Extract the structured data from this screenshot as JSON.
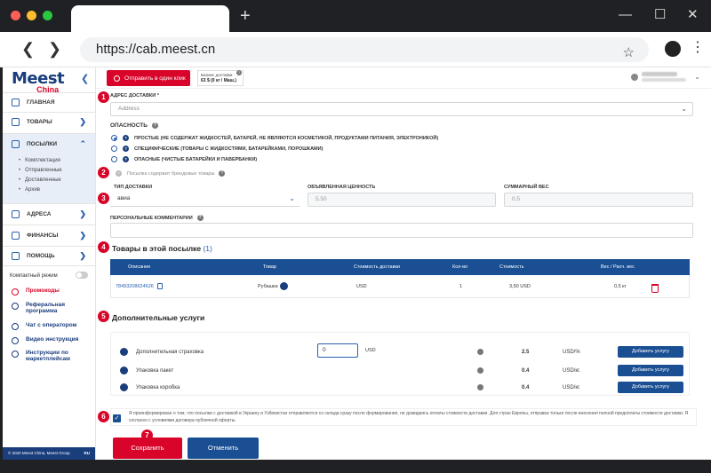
{
  "browser": {
    "url": "https://cab.meest.cn",
    "new_tab": "+",
    "back": "❮",
    "forward": "❯",
    "star": "☆",
    "menu": "⋮",
    "minimize": "—",
    "maximize": "☐",
    "close": "✕"
  },
  "sidebar": {
    "logo_main": "Meest",
    "logo_sub": "China",
    "collapse": "❮",
    "items": [
      {
        "label": "ГЛАВНАЯ"
      },
      {
        "label": "ТОВАРЫ"
      },
      {
        "label": "ПОСЫЛКИ"
      },
      {
        "label": "АДРЕСА"
      },
      {
        "label": "ФИНАНСЫ"
      },
      {
        "label": "ПОМОЩЬ"
      }
    ],
    "chevron_right": "❯",
    "chevron_down": "⌃",
    "subitems": [
      "Комплектация",
      "Отправленные",
      "Доставленные",
      "Архив"
    ],
    "compact_mode": "Компактный режим",
    "links": [
      {
        "label": "Промокоды"
      },
      {
        "label": "Реферальная программа"
      },
      {
        "label": "Чат с оператором"
      },
      {
        "label": "Видео инструкция"
      },
      {
        "label": "Инструкции по маркетплейсам"
      }
    ],
    "footer": "© 2020 Meest China, Meest Group",
    "lang": "RU"
  },
  "header": {
    "send_button": "Отправить в один клик",
    "balance_label": "Баланс доставки",
    "balance_value": "63 $ (0 кг / Маш.)",
    "help": "?",
    "dropdown": "⌄"
  },
  "form": {
    "address_label": "АДРЕС ДОСТАВКИ *",
    "address_placeholder": "Address",
    "danger_label": "ОПАСНОСТЬ",
    "help": "?",
    "dropdown": "⌄",
    "danger_options": [
      {
        "label": "ПРОСТЫЕ (НЕ СОДЕРЖАТ ЖИДКОСТЕЙ, БАТАРЕЙ, НЕ ЯВЛЯЮТСЯ КОСМЕТИКОЙ, ПРОДУКТАМИ ПИТАНИЯ, ЭЛЕКТРОНИКОЙ)",
        "selected": true
      },
      {
        "label": "СПЕЦИФИЧЕСКИЕ (ТОВАРЫ С ЖИДКОСТЯМИ, БАТАРЕЙКАМИ, ПОРОШКАМИ)",
        "selected": false
      },
      {
        "label": "ОПАСНЫЕ (ЧИСТЫЕ БАТАРЕЙКИ И ПАВЕРБАНКИ)",
        "selected": false
      }
    ],
    "brand_checkbox": "Посылка содержит брендовые товары",
    "delivery_type_label": "ТИП ДОСТАВКИ",
    "delivery_type_value": "авиа",
    "declared_value_label": "ОБЪЯВЛЕННАЯ ЦЕННОСТЬ",
    "declared_value": "5.50",
    "total_weight_label": "СУММАРНЫЙ ВЕС",
    "total_weight": "0.5",
    "comments_label": "ПЕРСОНАЛЬНЫЕ КОММЕНТАРИИ"
  },
  "steps": [
    "1",
    "2",
    "3",
    "4",
    "5",
    "6",
    "7"
  ],
  "goods": {
    "title": "Товары в этой посылке",
    "count": "(1)",
    "columns": [
      "Описание",
      "Товар",
      "Стоимость доставки",
      "Кол-во",
      "Стоимость",
      "Вес / Расч. вес"
    ],
    "row": {
      "description": "78493208624626",
      "item": "Рубашка",
      "delivery_cost": "USD",
      "qty": "1",
      "cost": "3,50 USD",
      "weight": "0,5 кг"
    }
  },
  "services": {
    "title": "Дополнительные услуги",
    "help": "?",
    "insurance_input": "0",
    "insurance_currency": "USD",
    "rows": [
      {
        "name": "Дополнительная страховка",
        "value": "2.5",
        "unit": "USD/%",
        "button": "Добавить услугу"
      },
      {
        "name": "Упаковка пакет",
        "value": "0.4",
        "unit": "USD/кг.",
        "button": "Добавить услугу"
      },
      {
        "name": "Упаковка коробка",
        "value": "0.4",
        "unit": "USD/кг.",
        "button": "Добавить услугу"
      }
    ]
  },
  "agreement": {
    "checked": "✓",
    "text": "Я проинформирован о том, что посылки с доставкой в Украину и Узбекистан отправляются со склада сразу после формирования, не дожидаясь оплаты стоимости доставки. Для стран Европы, отправка только после внесения полной предоплаты стоимости доставки. Я согласен с условиями договора публичной оферты."
  },
  "actions": {
    "save": "Сохранить",
    "cancel": "Отменить"
  }
}
